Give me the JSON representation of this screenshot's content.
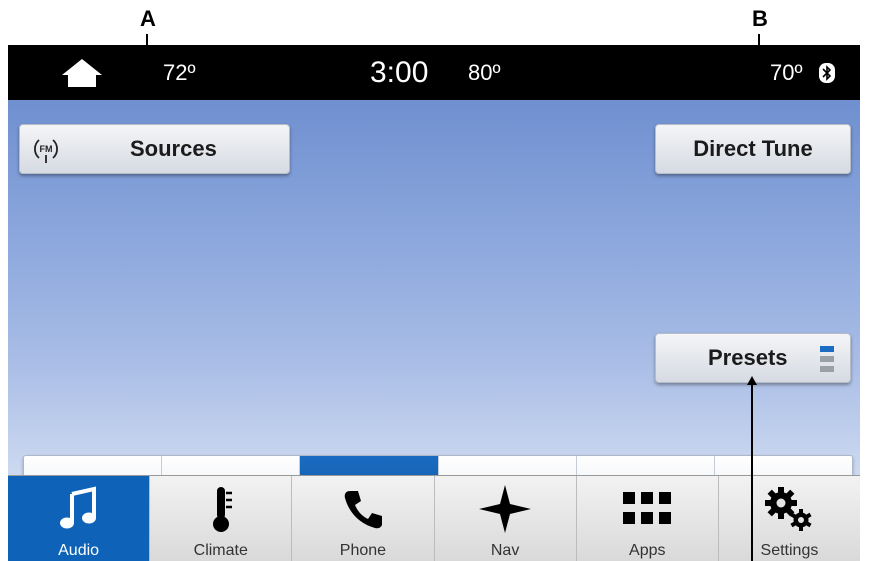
{
  "callouts": {
    "a": "A",
    "b": "B"
  },
  "status_bar": {
    "outside_temp": "72º",
    "time": "3:00",
    "cabin_temp": "80º",
    "right_temp": "70º"
  },
  "audio": {
    "sources_label": "Sources",
    "source_badge": "FM",
    "direct_tune_label": "Direct Tune",
    "presets_label": "Presets"
  },
  "presets": {
    "slot_count": 6,
    "active_index": 2
  },
  "nav": {
    "tabs": [
      {
        "label": "Audio",
        "icon": "music-note-icon",
        "active": true
      },
      {
        "label": "Climate",
        "icon": "thermometer-icon",
        "active": false
      },
      {
        "label": "Phone",
        "icon": "phone-icon",
        "active": false
      },
      {
        "label": "Nav",
        "icon": "compass-star-icon",
        "active": false
      },
      {
        "label": "Apps",
        "icon": "apps-grid-icon",
        "active": false
      },
      {
        "label": "Settings",
        "icon": "gears-icon",
        "active": false
      }
    ]
  },
  "colors": {
    "accent_blue": "#0e62b8",
    "status_bar_bg": "#000000",
    "screen_bg_top": "#6f8fcf",
    "screen_bg_bottom": "#cdd9f0"
  }
}
